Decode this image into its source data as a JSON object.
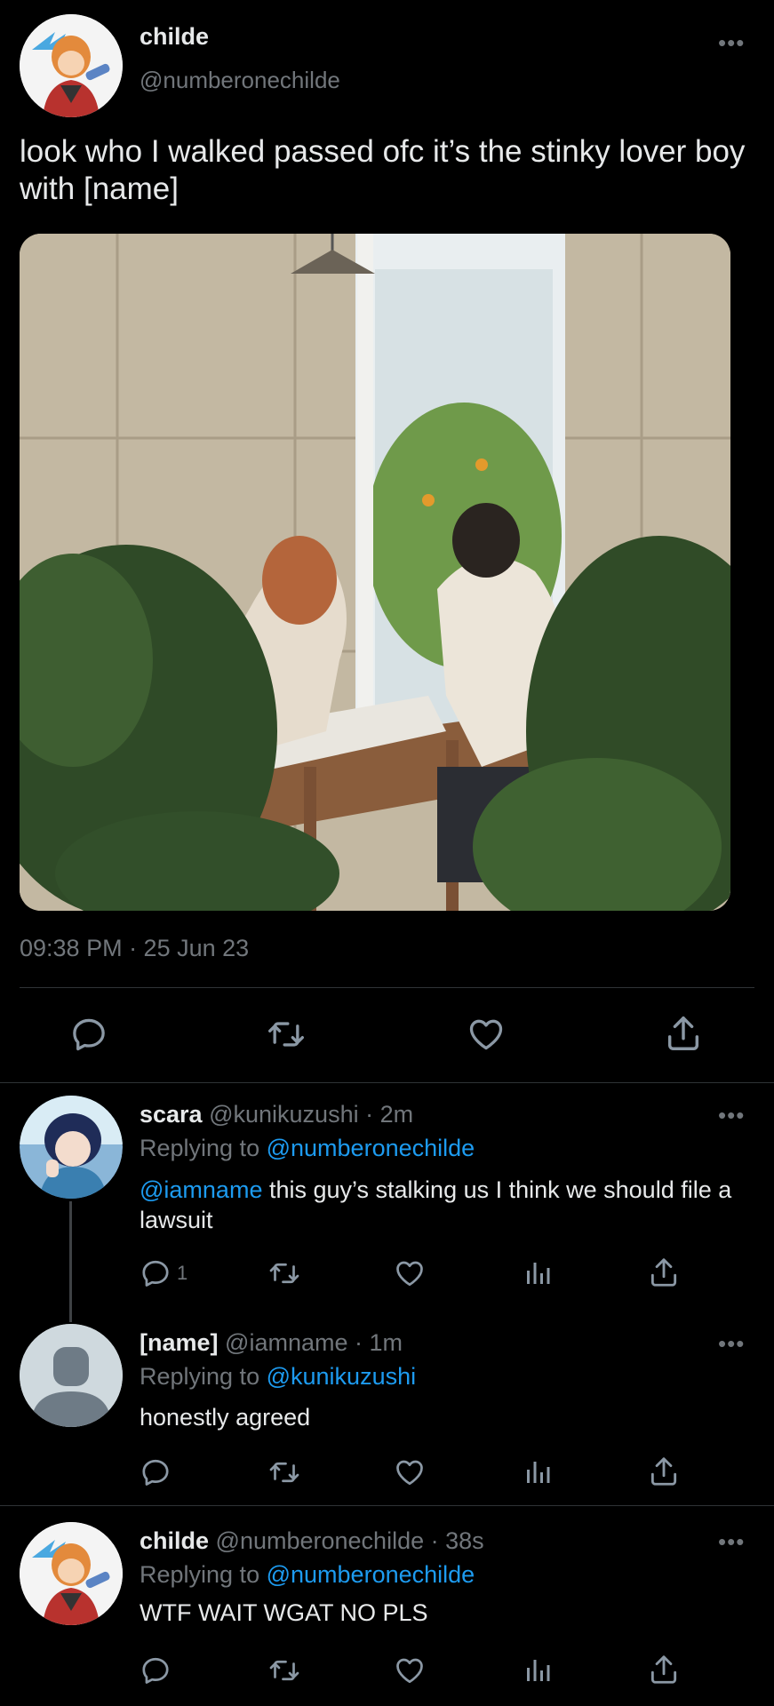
{
  "main_tweet": {
    "display_name": "childe",
    "handle": "@numberonechilde",
    "text": "look who I walked passed ofc it’s the stinky lover boy with [name]",
    "timestamp": "09:38 PM · 25 Jun 23"
  },
  "replies": [
    {
      "display_name": "scara",
      "handle": "@kunikuzushi",
      "time": "· 2m",
      "replying_prefix": "Replying to",
      "replying_to": "@numberonechilde",
      "mention": "@iamname",
      "text": " this guy’s stalking us I think we should file a lawsuit",
      "reply_count": "1"
    },
    {
      "display_name": "[name]",
      "handle": "@iamname",
      "time": "· 1m",
      "replying_prefix": "Replying to",
      "replying_to": "@kunikuzushi",
      "text": "honestly agreed"
    },
    {
      "display_name": "childe",
      "handle": "@numberonechilde",
      "time": "· 38s",
      "replying_prefix": "Replying to",
      "replying_to": "@numberonechilde",
      "text": "WTF WAIT WGAT NO PLS"
    }
  ],
  "icons": [
    "reply-icon",
    "retweet-icon",
    "like-icon",
    "views-icon",
    "share-icon",
    "more-icon"
  ],
  "colors": {
    "background": "#000000",
    "text": "#e7e9ea",
    "muted": "#71767b",
    "link": "#1d9bf0",
    "divider": "#2f3336"
  }
}
